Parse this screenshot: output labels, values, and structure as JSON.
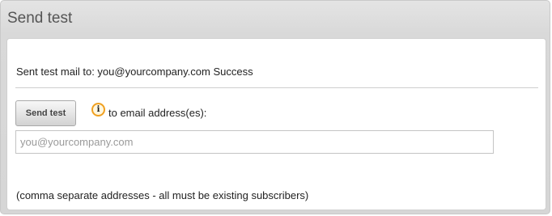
{
  "panel": {
    "title": "Send test"
  },
  "status": {
    "text": "Sent test mail to: you@yourcompany.com Success"
  },
  "send": {
    "button_label": "Send test",
    "info_icon": "info-icon",
    "info_glyph": "i",
    "address_label": "to email address(es):"
  },
  "address_input": {
    "value": "",
    "placeholder": "you@yourcompany.com"
  },
  "hint": {
    "text": "(comma separate addresses - all must be existing subscribers)"
  },
  "colors": {
    "info_icon_ring": "#f0a020",
    "panel_header": "#dcdcdc"
  }
}
